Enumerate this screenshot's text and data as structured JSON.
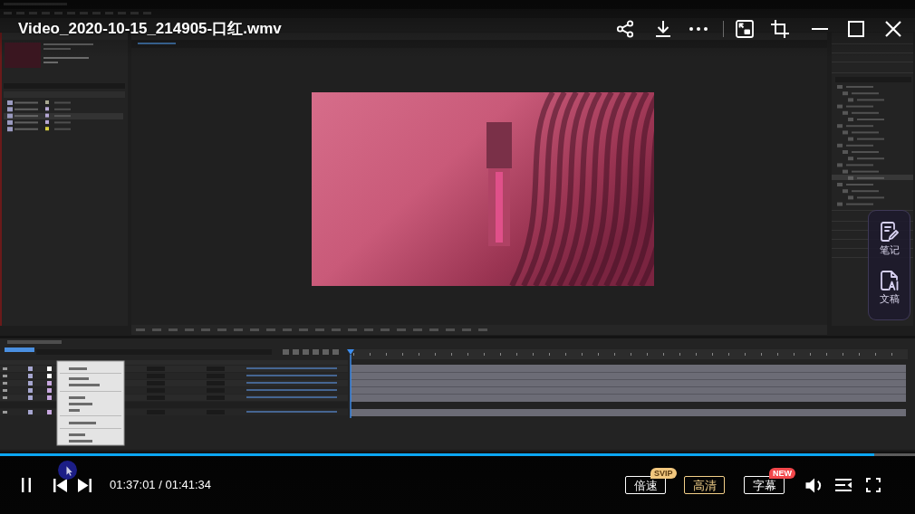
{
  "player": {
    "title": "Video_2020-10-15_214905-口红.wmv"
  },
  "side_panel": {
    "items": [
      {
        "kind": "note",
        "label": "笔记"
      },
      {
        "kind": "transcript",
        "label": "文稿"
      }
    ]
  },
  "progress": {
    "level": 0.955
  },
  "controls": {
    "playing": true,
    "time": "01:37:01 / 01:41:34",
    "options": [
      {
        "label": "倍速",
        "highlighted": false,
        "badge": {
          "text": "SVIP",
          "color": "#f2c77e"
        }
      },
      {
        "label": "高清",
        "highlighted": true
      },
      {
        "label": "字幕",
        "highlighted": false,
        "badge": {
          "text": "NEW",
          "color": "#f2474b"
        }
      }
    ]
  }
}
